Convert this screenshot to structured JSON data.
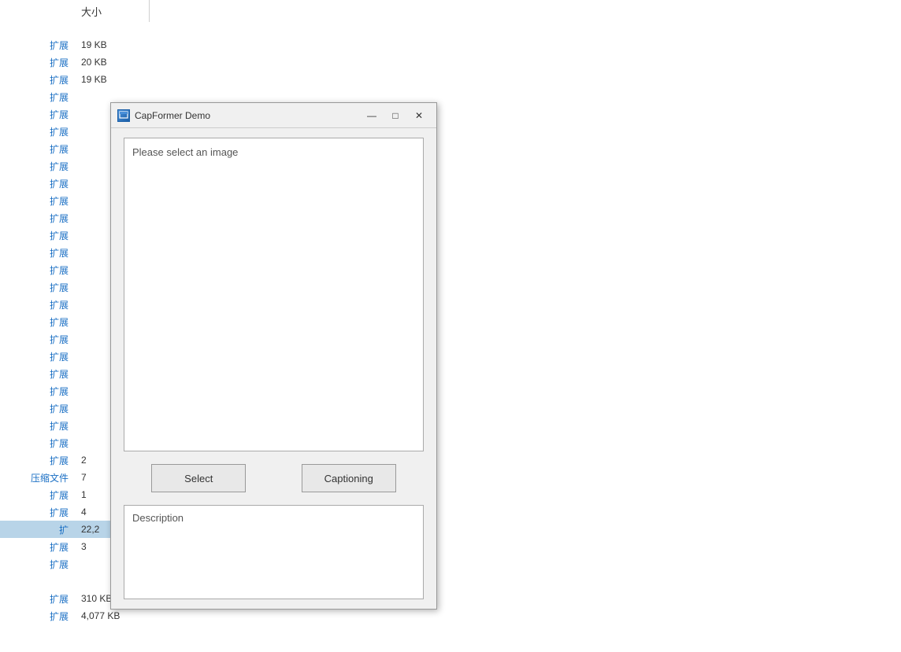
{
  "background": {
    "header": {
      "size_col": "大小"
    },
    "rows": [
      {
        "label": "扩展",
        "size": "19 KB",
        "highlighted": false
      },
      {
        "label": "扩展",
        "size": "20 KB",
        "highlighted": false
      },
      {
        "label": "扩展",
        "size": "19 KB",
        "highlighted": false
      },
      {
        "label": "扩展",
        "size": "",
        "highlighted": false
      },
      {
        "label": "扩展",
        "size": "",
        "highlighted": false
      },
      {
        "label": "扩展",
        "size": "",
        "highlighted": false
      },
      {
        "label": "扩展",
        "size": "",
        "highlighted": false
      },
      {
        "label": "扩展",
        "size": "",
        "highlighted": false
      },
      {
        "label": "扩展",
        "size": "",
        "highlighted": false
      },
      {
        "label": "扩展",
        "size": "",
        "highlighted": false
      },
      {
        "label": "扩展",
        "size": "",
        "highlighted": false
      },
      {
        "label": "扩展",
        "size": "",
        "highlighted": false
      },
      {
        "label": "扩展",
        "size": "",
        "highlighted": false
      },
      {
        "label": "扩展",
        "size": "",
        "highlighted": false
      },
      {
        "label": "扩展",
        "size": "",
        "highlighted": false
      },
      {
        "label": "扩展",
        "size": "2",
        "highlighted": false
      },
      {
        "label": "压缩文件",
        "size": "7",
        "highlighted": false
      },
      {
        "label": "扩展",
        "size": "1",
        "highlighted": false
      },
      {
        "label": "扩展",
        "size": "4",
        "highlighted": false
      },
      {
        "label": "扩",
        "size": "22,2",
        "highlighted": true
      },
      {
        "label": "扩展",
        "size": "3",
        "highlighted": false
      },
      {
        "label": "扩展",
        "size": "",
        "highlighted": false
      },
      {
        "label": "扩展",
        "size": "310 KB",
        "highlighted": false
      },
      {
        "label": "扩展",
        "size": "4,077 KB",
        "highlighted": false
      }
    ]
  },
  "window": {
    "title": "CapFormer Demo",
    "icon": "C",
    "minimize_label": "—",
    "maximize_label": "□",
    "close_label": "✕",
    "image_placeholder": "Please select an image",
    "select_button": "Select",
    "captioning_button": "Captioning",
    "description_label": "Description"
  }
}
